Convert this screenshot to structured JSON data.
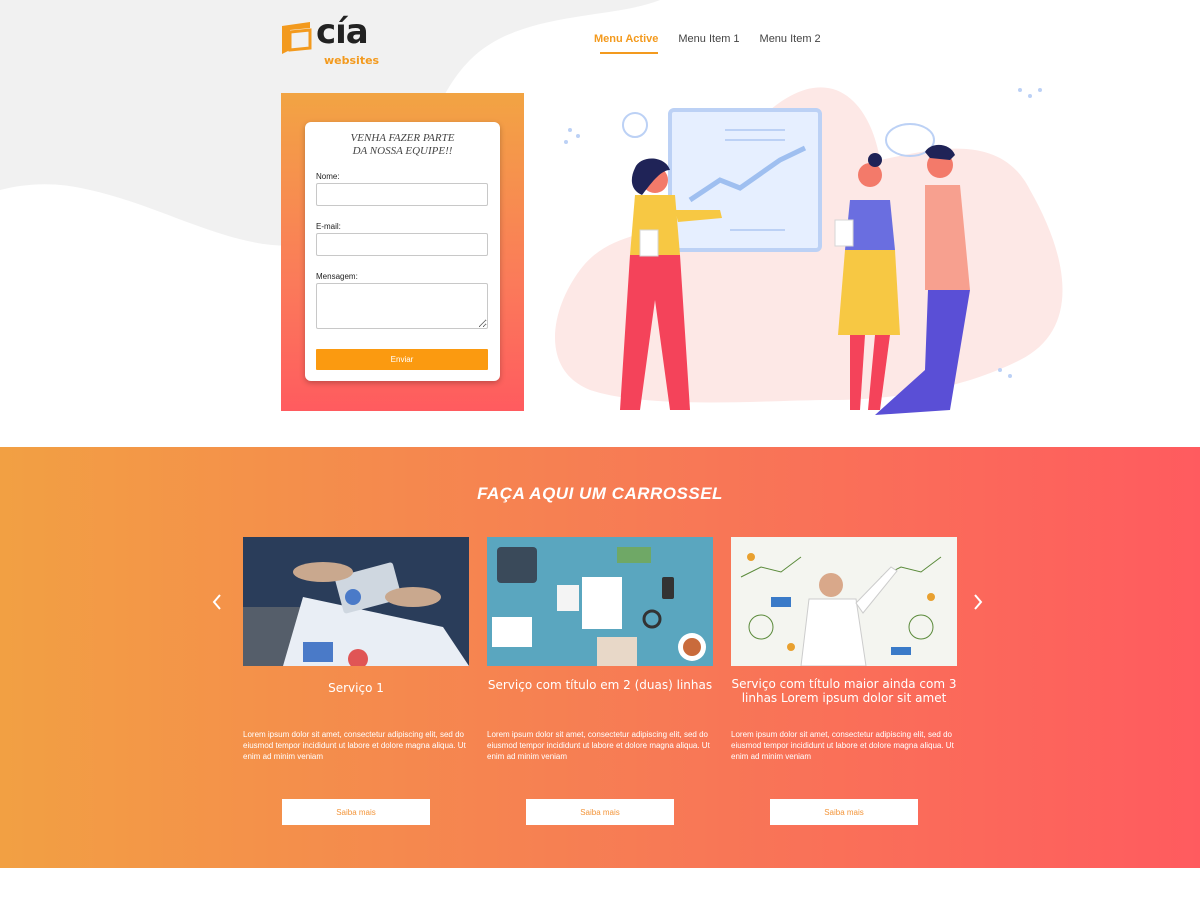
{
  "logo": {
    "main": "cía",
    "sub": "websites"
  },
  "nav": {
    "items": [
      {
        "label": "Menu Active",
        "active": true
      },
      {
        "label": "Menu Item 1",
        "active": false
      },
      {
        "label": "Menu Item 2",
        "active": false
      }
    ]
  },
  "form": {
    "title_line1": "VENHA FAZER PARTE",
    "title_line2": "DA NOSSA EQUIPE!!",
    "name_label": "Nome:",
    "email_label": "E-mail:",
    "message_label": "Mensagem:",
    "submit_label": "Enviar"
  },
  "carousel": {
    "title": "FAÇA AQUI UM CARROSSEL",
    "cards": [
      {
        "title": "Serviço 1",
        "text": "Lorem ipsum dolor sit amet, consectetur adipiscing elit, sed do eiusmod tempor incididunt ut labore et dolore magna aliqua. Ut enim ad minim veniam",
        "button": "Saiba mais"
      },
      {
        "title": "Serviço com título em 2 (duas) linhas",
        "text": "Lorem ipsum dolor sit amet, consectetur adipiscing elit, sed do eiusmod tempor incididunt ut labore et dolore magna aliqua. Ut enim ad minim veniam",
        "button": "Saiba mais"
      },
      {
        "title": "Serviço com título maior ainda com 3 linhas Lorem ipsum dolor sit amet",
        "text": "Lorem ipsum dolor sit amet, consectetur adipiscing elit, sed do eiusmod tempor incididunt ut labore et dolore magna aliqua. Ut enim ad minim veniam",
        "button": "Saiba mais"
      }
    ]
  },
  "colors": {
    "accent": "#f39a1e",
    "submit": "#fb9a10",
    "gradient_start": "#f2a043",
    "gradient_end": "#ff5b5f"
  },
  "icons": {
    "carousel_prev": "chevron-left-icon",
    "carousel_next": "chevron-right-icon"
  }
}
